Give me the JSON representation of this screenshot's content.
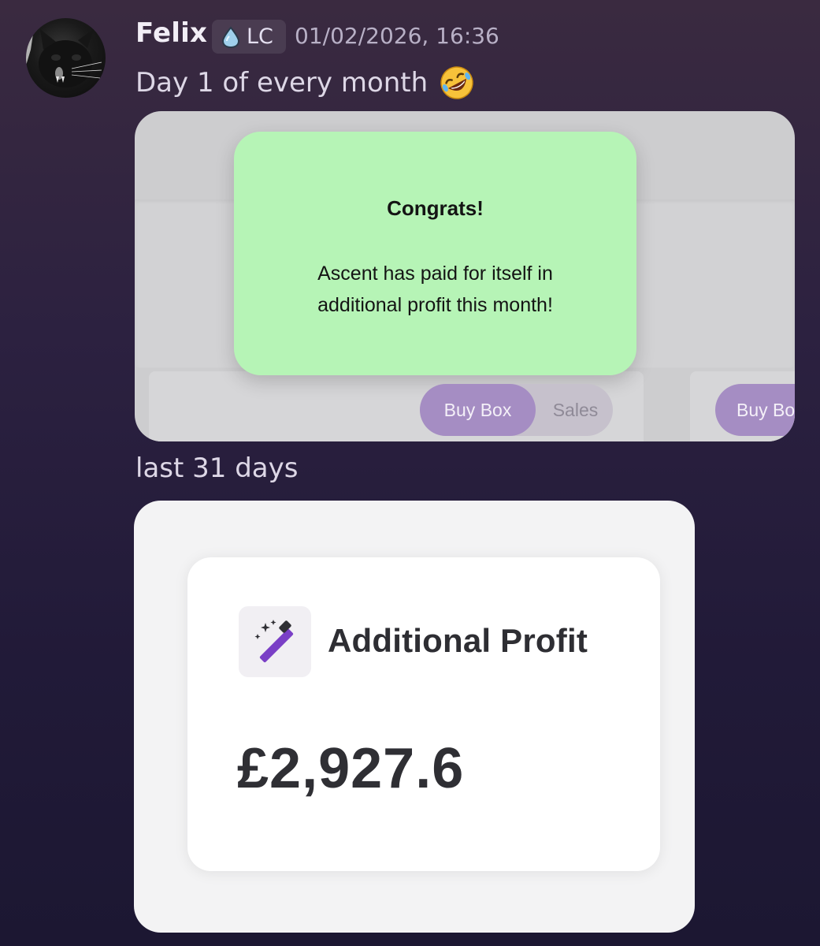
{
  "message": {
    "author": "Felix",
    "role_tag": "LC",
    "timestamp": "01/02/2026, 16:36",
    "text": "Day 1 of every month",
    "emoji": "rolling-on-the-floor-laughing-emoji"
  },
  "attachment_1": {
    "modal": {
      "title": "Congrats!",
      "body_line_1": "Ascent has paid for itself in",
      "body_line_2": "additional profit this month!",
      "background": "#b6f4b6"
    },
    "toggle": {
      "active_label": "Buy Box",
      "inactive_label": "Sales"
    },
    "partial_button_label": "Buy Bo",
    "accent": "#a58dc3"
  },
  "caption": "last 31 days",
  "attachment_2": {
    "icon": "magic-wand-icon",
    "label": "Additional Profit",
    "value": "£2,927.6"
  }
}
